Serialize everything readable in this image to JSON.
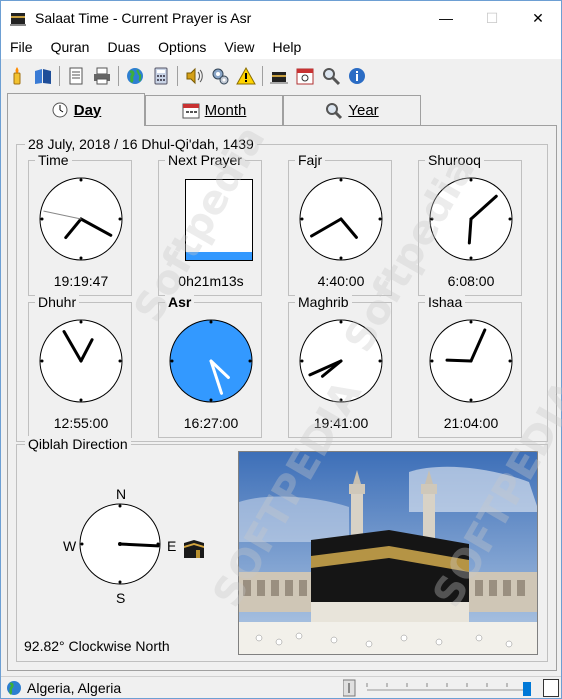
{
  "window": {
    "title": "Salaat Time - Current Prayer is Asr",
    "minimize": "—",
    "maximize": "☐",
    "close": "✕"
  },
  "menu": [
    "File",
    "Quran",
    "Duas",
    "Options",
    "View",
    "Help"
  ],
  "toolbar_icons": [
    "candle-icon",
    "book-icon",
    "document-icon",
    "printer-icon",
    "globe-icon",
    "calculator-icon",
    "speaker-icon",
    "gears-icon",
    "warning-icon",
    "mosque-icon",
    "calendar-icon",
    "magnifier-icon",
    "info-icon"
  ],
  "tabs": [
    {
      "label": "Day",
      "icon": "clock-icon",
      "active": true
    },
    {
      "label": "Month",
      "icon": "calendar-icon",
      "active": false
    },
    {
      "label": "Year",
      "icon": "magnifier-icon",
      "active": false
    }
  ],
  "day": {
    "date": "28 July, 2018 / 16 Dhul-Qi'dah, 1439",
    "clocks": [
      {
        "title": "Time",
        "time": "19:19:47",
        "bold": false
      },
      {
        "title": "Next Prayer",
        "time": "0h21m13s",
        "bold": false,
        "progress": 0.1
      },
      {
        "title": "Fajr",
        "time": "4:40:00",
        "bold": false
      },
      {
        "title": "Shurooq",
        "time": "6:08:00",
        "bold": false
      },
      {
        "title": "Dhuhr",
        "time": "12:55:00",
        "bold": false
      },
      {
        "title": "Asr",
        "time": "16:27:00",
        "bold": true,
        "highlight": "#3399ff"
      },
      {
        "title": "Maghrib",
        "time": "19:41:00",
        "bold": false
      },
      {
        "title": "Ishaa",
        "time": "21:04:00",
        "bold": false
      }
    ]
  },
  "qiblah": {
    "title": "Qiblah Direction",
    "north": "N",
    "south": "S",
    "east": "E",
    "west": "W",
    "bearing_degrees": 92.82,
    "caption": "92.82° Clockwise North"
  },
  "status": {
    "location": "Algeria, Algeria"
  },
  "watermarks": [
    "Softpedia",
    "SOFTPEDIA"
  ]
}
